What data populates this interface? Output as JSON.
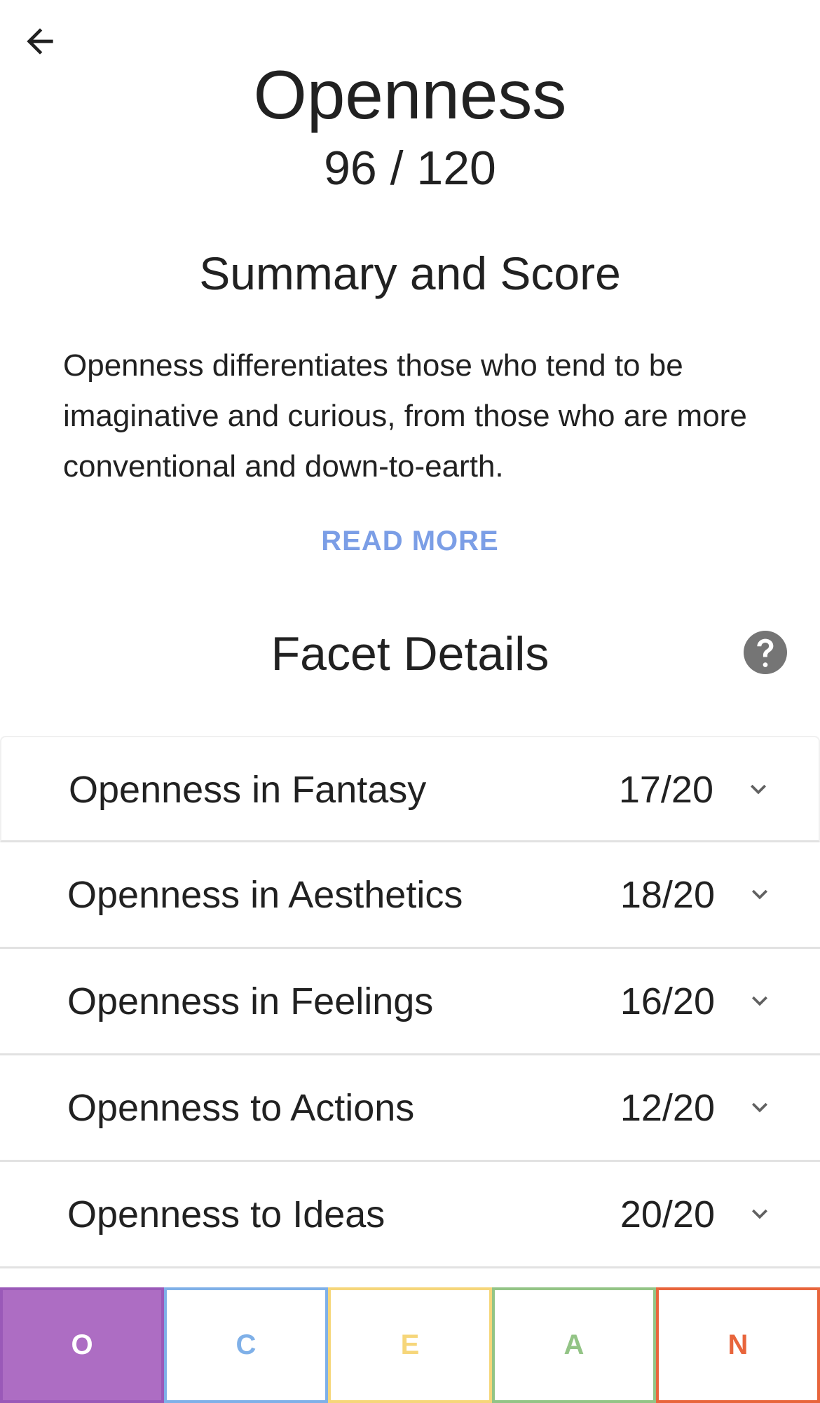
{
  "header": {
    "back_icon": "arrow-left-icon",
    "title": "Openness",
    "score": "96 / 120"
  },
  "summary": {
    "heading": "Summary and Score",
    "text": "Openness differentiates those who tend to be imaginative and curious, from those who are more conventional and down-to-earth.",
    "read_more_label": "READ MORE"
  },
  "facets": {
    "heading": "Facet Details",
    "help_icon": "help-circle-icon",
    "items": [
      {
        "name": "Openness in Fantasy",
        "score": "17/20"
      },
      {
        "name": "Openness in Aesthetics",
        "score": "18/20"
      },
      {
        "name": "Openness in Feelings",
        "score": "16/20"
      },
      {
        "name": "Openness to Actions",
        "score": "12/20"
      },
      {
        "name": "Openness to Ideas",
        "score": "20/20"
      }
    ]
  },
  "tabs": [
    {
      "label": "O",
      "color": "#ad6dc3",
      "selected": true
    },
    {
      "label": "C",
      "color": "#7fb0e8",
      "selected": false
    },
    {
      "label": "E",
      "color": "#f6d67a",
      "selected": false
    },
    {
      "label": "A",
      "color": "#93c486",
      "selected": false
    },
    {
      "label": "N",
      "color": "#e8653c",
      "selected": false
    }
  ],
  "colors": {
    "accent_link": "#7b9ee6",
    "text": "#212121",
    "icon_gray": "#757575"
  }
}
